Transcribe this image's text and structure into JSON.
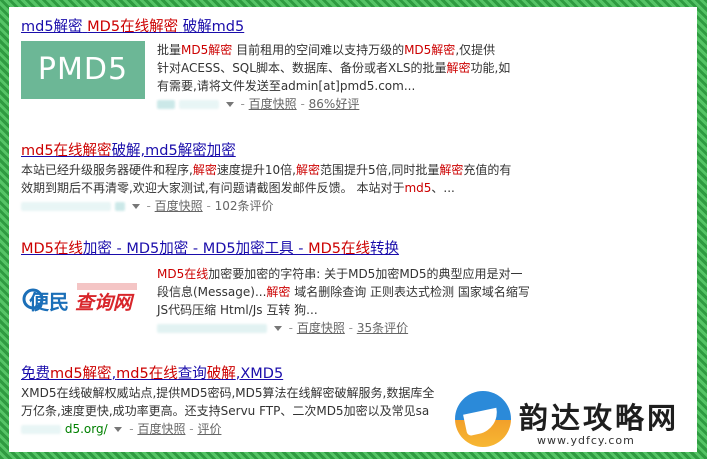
{
  "results": [
    {
      "title_parts": [
        "md5解密",
        "MD5在线解密",
        "破解md5"
      ],
      "thumbnail_text": "PMD5",
      "body": {
        "line1_pre": "批量",
        "line1_hl1": "MD5解密",
        "line1_mid": " 目前租用的空间难以支持万级的",
        "line1_hl2": "MD5解密",
        "line1_post": ",仅提供",
        "line2_pre": "针对ACESS、SQL脚本、数据库、备份或者XLS的批量",
        "line2_hl": "解密",
        "line2_post": "功能,如",
        "line3": "有需要,请将文件发送至admin[at]pmd5.com..."
      },
      "meta": {
        "snapshot": "百度快照",
        "rating": "86%好评"
      }
    },
    {
      "title": "md5在线解密破解,md5解密加密",
      "title_hl": "md5在线解密",
      "title_rest": "破解,md5解密加密",
      "body": {
        "l1_pre": "本站已经升级服务器硬件和程序,",
        "l1_hl1": "解密",
        "l1_mid": "速度提升10倍,",
        "l1_hl2": "解密",
        "l1_mid2": "范围提升5倍,同时批量",
        "l1_hl3": "解密",
        "l1_post": "充值的有",
        "l2_pre": "效期到期后不再清零,欢迎大家测试,有问题请截图发邮件反馈。 本站对于",
        "l2_hl": "md5",
        "l2_post": "、..."
      },
      "meta": {
        "snapshot": "百度快照",
        "reviews": "102条评价"
      }
    },
    {
      "title_hl1": "MD5在线",
      "title_mid1": "加密 - MD5加密 - MD5加密工具 - ",
      "title_hl2": "MD5在线",
      "title_rest": "转换",
      "thumbnail_text": "便民查询网",
      "body": {
        "l1_hl": "MD5在线",
        "l1_post": "加密要加密的字符串: 关于MD5加密MD5的典型应用是对一",
        "l2_pre": "段信息(Message)...",
        "l2_hl": "解密",
        "l2_post": " 域名删除查询 正则表达式检测 国家域名缩写",
        "l3": "JS代码压缩 Html/Js 互转 狗..."
      },
      "meta": {
        "snapshot": "百度快照",
        "reviews": "35条评价"
      }
    },
    {
      "title_pre": "免费",
      "title_hl1": "md5解密",
      "title_mid": ",",
      "title_hl2": "md5在线",
      "title_mid2": "查询",
      "title_hl3": "破解",
      "title_rest": ",XMD5",
      "body": {
        "l1": "XMD5在线破解权威站点,提供MD5密码,MD5算法在线解密破解服务,数据库全",
        "l2": "万亿条,速度更快,成功率更高。还支持Servu FTP、二次MD5加密以及常见sa"
      },
      "meta": {
        "url_part": "d5.org/",
        "snapshot": "百度快照",
        "reviews": "评价"
      }
    }
  ],
  "watermark": {
    "name": "韵达攻略网",
    "url": "www.ydfcy.com"
  }
}
